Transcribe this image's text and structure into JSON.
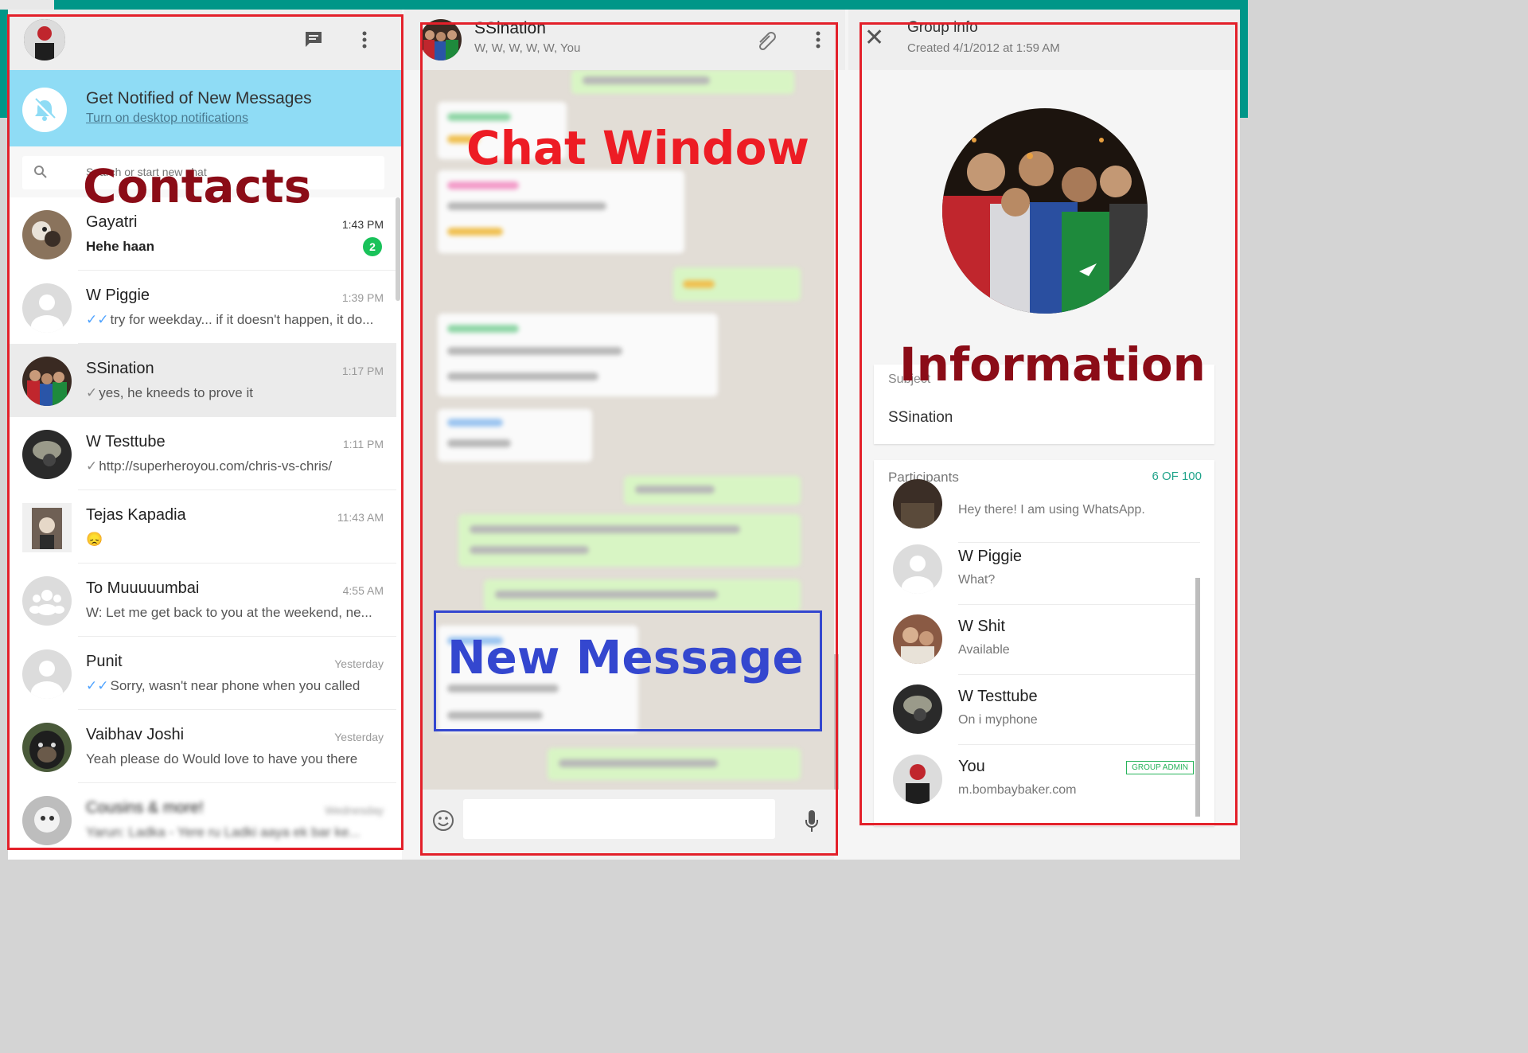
{
  "colors": {
    "teal_bar": "#009688",
    "notification_banner": "#8fdcf5",
    "unread_badge": "#19c25a",
    "outgoing_bubble": "#d8f5c4",
    "annotation_red": "#e3202a",
    "annotation_blue": "#3447cf"
  },
  "left": {
    "header_icons": [
      "new-chat-icon",
      "menu-dots-icon"
    ],
    "notification": {
      "title": "Get Notified of New Messages",
      "link": "Turn on desktop notifications",
      "icon": "bell-off-icon"
    },
    "search": {
      "placeholder": "Search or start new chat",
      "icon": "search-icon"
    },
    "chats": [
      {
        "name": "Gayatri",
        "time": "1:43 PM",
        "message": "Hehe haan",
        "unread": "2",
        "avatar": "#5a4636"
      },
      {
        "name": "W Piggie",
        "time": "1:39 PM",
        "message": "try for weekday... if it doesn't happen, it do...",
        "ticks": "✓✓",
        "avatar": "#dcdcdc"
      },
      {
        "name": "SSination",
        "time": "1:17 PM",
        "message": "yes, he kneeds to prove it",
        "tick": "✓",
        "avatar": "#4e3a30"
      },
      {
        "name": "W Testtube",
        "time": "1:11 PM",
        "message": "http://superheroyou.com/chris-vs-chris/",
        "tick": "✓",
        "avatar": "#3a3a3a"
      },
      {
        "name": "Tejas Kapadia",
        "time": "11:43 AM",
        "message": "😞",
        "avatar": "#7a6a5a"
      },
      {
        "name": "To Muuuuumbai",
        "time": "4:55 AM",
        "message": "W: Let me get back to you at the weekend, ne...",
        "avatar": "#dcdcdc"
      },
      {
        "name": "Punit",
        "time": "Yesterday",
        "message": "Sorry, wasn't near phone when you called",
        "ticks": "✓✓",
        "avatar": "#dcdcdc"
      },
      {
        "name": "Vaibhav Joshi",
        "time": "Yesterday",
        "message": "Yeah please do Would love to have you there",
        "avatar": "#2e2e2e"
      },
      {
        "name": "Cousins & more!",
        "time": "Wednesday",
        "message": "Yarun: Ladka - Yere ru Ladki aaya ek bar ke...",
        "avatar": "#cfcfcf"
      }
    ]
  },
  "center": {
    "title": "SSination",
    "subtitle": "W, W, W, W, W, You",
    "header_icons": [
      "attach-icon",
      "menu-dots-icon"
    ],
    "composer_icons": [
      "emoji-icon",
      "microphone-icon"
    ]
  },
  "right": {
    "title": "Group info",
    "created": "Created 4/1/2012 at 1:59 AM",
    "subject_label": "Subject",
    "subject": "SSination",
    "participants_label": "Participants",
    "participants_count": "6 OF 100",
    "participants": [
      {
        "name": "",
        "status": "Hey there! I am using WhatsApp.",
        "avatar": "#3b2e26"
      },
      {
        "name": "W Piggie",
        "status": "What?",
        "avatar": "#dcdcdc"
      },
      {
        "name": "W Shit",
        "status": "Available",
        "avatar": "#8a5a44"
      },
      {
        "name": "W Testtube",
        "status": "On i myphone",
        "avatar": "#3a3a3a"
      },
      {
        "name": "You",
        "status": "m.bombaybaker.com",
        "avatar": "#2c2c2c",
        "badge": "GROUP ADMIN"
      }
    ]
  },
  "annotations": {
    "contacts": "Contacts",
    "chat_window": "Chat Window",
    "new_message": "New Message",
    "information": "Information"
  }
}
